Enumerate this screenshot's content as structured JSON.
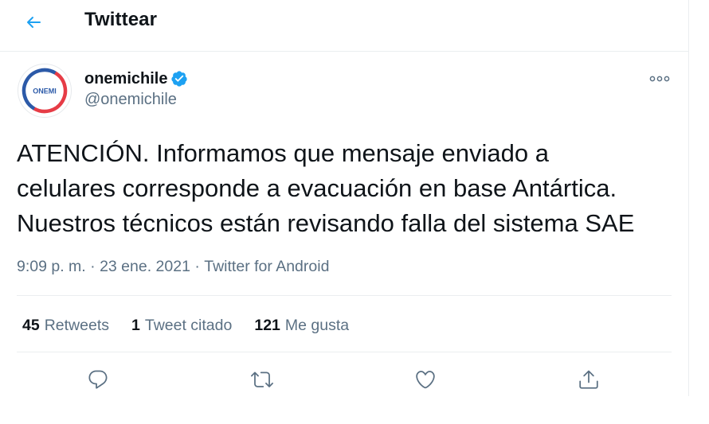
{
  "header": {
    "title": "Twittear",
    "back_icon": "arrow-left-icon"
  },
  "author": {
    "display_name": "onemichile",
    "handle": "@onemichile",
    "avatar_text": "ONEMI",
    "verified_icon": "verified-badge-icon"
  },
  "tweet": {
    "text": "ATENCIÓN. Informamos que mensaje enviado a\ncelulares corresponde a evacuación en base  Antártica.\nNuestros técnicos están revisando falla del sistema SAE",
    "time": "9:09 p. m.",
    "separator": " · ",
    "date": "23 ene. 2021",
    "source": "Twitter for Android"
  },
  "stats": {
    "retweets_count": "45",
    "retweets_label": "Retweets",
    "quotes_count": "1",
    "quotes_label": "Tweet citado",
    "likes_count": "121",
    "likes_label": "Me gusta"
  },
  "actions": {
    "reply_icon": "reply-icon",
    "retweet_icon": "retweet-icon",
    "like_icon": "heart-icon",
    "share_icon": "share-icon"
  },
  "colors": {
    "accent": "#1da1f2",
    "text_primary": "#0f1419",
    "text_secondary": "#5b7083",
    "divider": "#ebeef0",
    "avatar_red": "#e63c46",
    "avatar_blue": "#2c5aa8"
  }
}
